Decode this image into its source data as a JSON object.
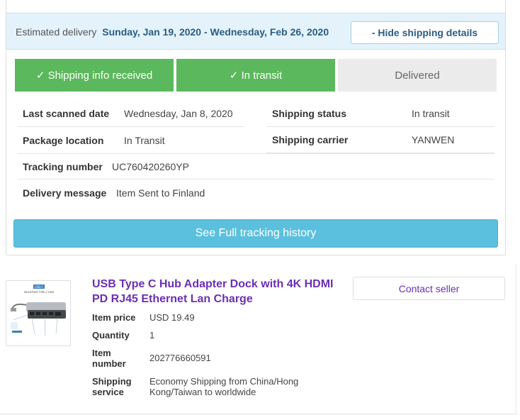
{
  "delivery": {
    "label": "Estimated delivery",
    "dates": "Sunday, Jan 19, 2020 - Wednesday, Feb 26, 2020",
    "hide_button": "- Hide shipping details"
  },
  "steps": [
    {
      "label": "✓ Shipping info received",
      "state": "done"
    },
    {
      "label": "✓ In transit",
      "state": "done"
    },
    {
      "label": "Delivered",
      "state": "pending"
    }
  ],
  "info": {
    "last_scanned_label": "Last scanned date",
    "last_scanned_value": "Wednesday, Jan 8, 2020",
    "shipping_status_label": "Shipping status",
    "shipping_status_value": "In transit",
    "package_location_label": "Package location",
    "package_location_value": "In Transit",
    "shipping_carrier_label": "Shipping carrier",
    "shipping_carrier_value": "YANWEN",
    "tracking_number_label": "Tracking number",
    "tracking_number_value": "UC760420260YP",
    "delivery_message_label": "Delivery message",
    "delivery_message_value": "Item Sent to Finland"
  },
  "tracking_button": "See Full tracking history",
  "product": {
    "title": "USB Type C Hub Adapter Dock with 4K HDMI PD RJ45 Ethernet Lan Charge",
    "contact_button": "Contact seller",
    "item_price_label": "Item price",
    "item_price_value": "USD 19.49",
    "quantity_label": "Quantity",
    "quantity_value": "1",
    "item_number_label": "Item number",
    "item_number_value": "202776660591",
    "shipping_service_label": "Shipping service",
    "shipping_service_value": "Economy Shipping from China/Hong Kong/Taiwan to worldwide",
    "thumbnail_badge": "USB-C",
    "thumbnail_caption": "MULTIPORT TYPE-C HUB"
  },
  "colors": {
    "step_done": "#5cb85c",
    "step_pending": "#ebebeb",
    "tracking_button": "#5bc0de",
    "link_purple": "#6b2fb3",
    "banner_bg": "#e4f3fb"
  }
}
